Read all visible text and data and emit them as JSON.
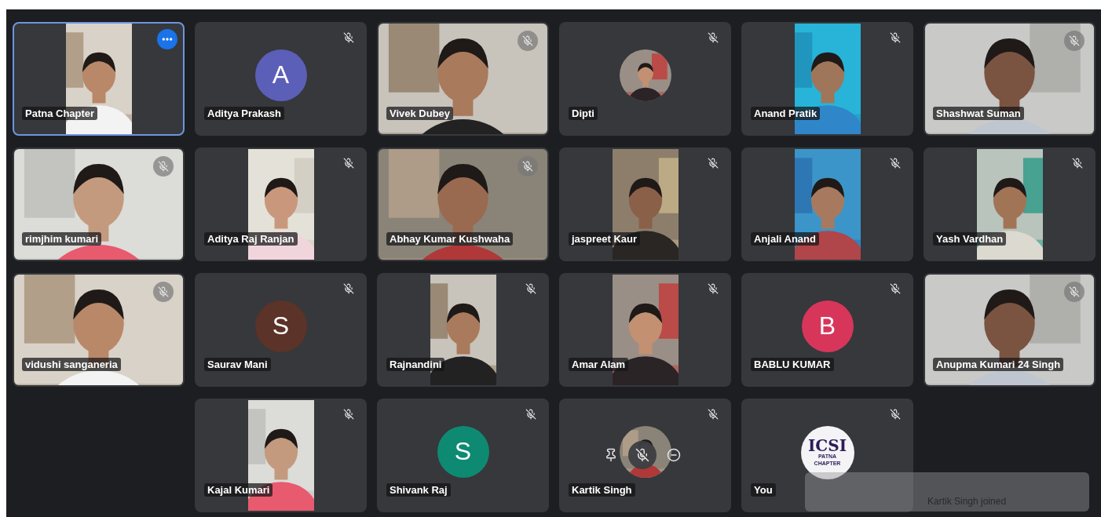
{
  "grid_rows": [
    {
      "tiles": [
        {
          "name": "Patna Chapter",
          "kind": "portrait_video",
          "muted": false,
          "selected": true,
          "hovered": false
        },
        {
          "name": "Aditya Prakash",
          "kind": "avatar",
          "letter": "A",
          "color": "#5c5fb8",
          "muted": true,
          "selected": false,
          "hovered": false
        },
        {
          "name": "Vivek Dubey",
          "kind": "video",
          "muted": true,
          "selected": false,
          "hovered": false
        },
        {
          "name": "Dipti",
          "kind": "photo_avatar",
          "muted": true,
          "selected": false,
          "hovered": false
        },
        {
          "name": "Anand Pratik",
          "kind": "portrait_video",
          "muted": true,
          "selected": false,
          "hovered": false
        },
        {
          "name": "Shashwat Suman",
          "kind": "video",
          "muted": true,
          "selected": false,
          "hovered": false
        }
      ]
    },
    {
      "tiles": [
        {
          "name": "rimjhim kumari",
          "kind": "video",
          "muted": true,
          "selected": false,
          "hovered": false
        },
        {
          "name": "Aditya Raj Ranjan",
          "kind": "portrait_video",
          "muted": true,
          "selected": false,
          "hovered": false
        },
        {
          "name": "Abhay Kumar Kushwaha",
          "kind": "video",
          "muted": true,
          "selected": false,
          "hovered": false
        },
        {
          "name": "jaspreet Kaur",
          "kind": "portrait_video",
          "muted": true,
          "selected": false,
          "hovered": false
        },
        {
          "name": "Anjali Anand",
          "kind": "portrait_video",
          "muted": true,
          "selected": false,
          "hovered": false
        },
        {
          "name": "Yash Vardhan",
          "kind": "portrait_video",
          "muted": true,
          "selected": false,
          "hovered": false
        }
      ]
    },
    {
      "tiles": [
        {
          "name": "vidushi sanganeria",
          "kind": "video",
          "muted": true,
          "selected": false,
          "hovered": false
        },
        {
          "name": "Saurav Mani",
          "kind": "avatar",
          "letter": "S",
          "color": "#5b3328",
          "muted": true,
          "selected": false,
          "hovered": false
        },
        {
          "name": "Rajnandini",
          "kind": "portrait_video",
          "muted": true,
          "selected": false,
          "hovered": false
        },
        {
          "name": "Amar Alam",
          "kind": "portrait_video",
          "muted": true,
          "selected": false,
          "hovered": false
        },
        {
          "name": "BABLU KUMAR",
          "kind": "avatar",
          "letter": "B",
          "color": "#d7365a",
          "muted": true,
          "selected": false,
          "hovered": false
        },
        {
          "name": "Anupma Kumari 24 Singh",
          "kind": "video",
          "muted": true,
          "selected": false,
          "hovered": false
        }
      ]
    },
    {
      "tiles": [
        {
          "name": "Kajal Kumari",
          "kind": "portrait_video",
          "muted": true,
          "selected": false,
          "hovered": false
        },
        {
          "name": "Shivank Raj",
          "kind": "avatar",
          "letter": "S",
          "color": "#0e8a73",
          "muted": true,
          "selected": false,
          "hovered": false
        },
        {
          "name": "Kartik Singh",
          "kind": "photo_avatar",
          "muted": true,
          "selected": false,
          "hovered": true
        },
        {
          "name": "You",
          "kind": "logo",
          "logo_lines": [
            "ICSI",
            "PATNA",
            "CHAPTER"
          ],
          "muted": true,
          "selected": false,
          "hovered": false
        }
      ]
    }
  ],
  "toast": {
    "text": "Kartik Singh joined"
  }
}
